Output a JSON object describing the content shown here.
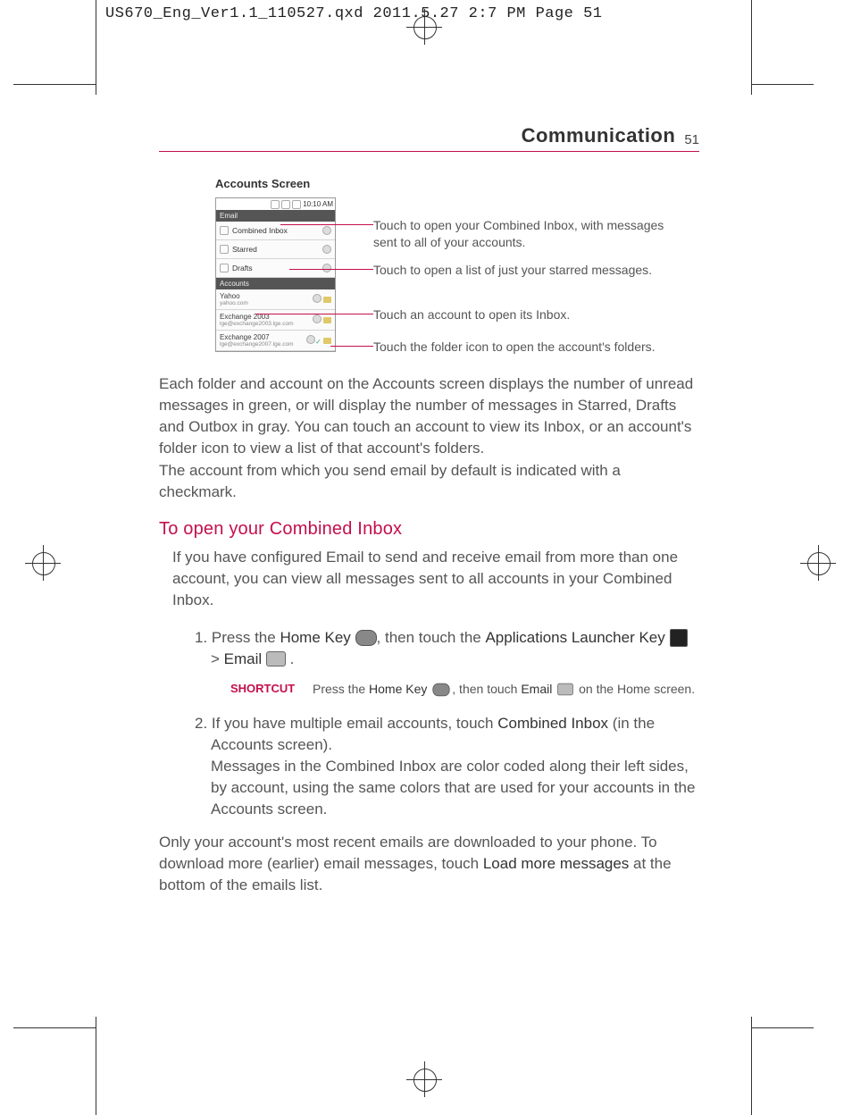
{
  "file_header": "US670_Eng_Ver1.1_110527.qxd  2011.5.27  2:7 PM  Page 51",
  "chapter": {
    "title": "Communication",
    "page_number": "51"
  },
  "figure_caption": "Accounts Screen",
  "phone": {
    "time": "10:10 AM",
    "section_email": "Email",
    "combined_inbox": "Combined Inbox",
    "starred": "Starred",
    "drafts": "Drafts",
    "section_accounts": "Accounts",
    "acc1_name": "Yahoo",
    "acc1_sub": "yahoo.com",
    "acc2_name": "Exchange 2003",
    "acc2_sub": "lge@exchange2003.lge.com",
    "acc3_name": "Exchange 2007",
    "acc3_sub": "lge@exchange2007.lge.com"
  },
  "callouts": {
    "c1": "Touch to open your Combined Inbox, with messages sent to all of your accounts.",
    "c2": "Touch to open a list of just your starred messages.",
    "c3": "Touch an account to open its Inbox.",
    "c4": "Touch the folder icon to open the account's folders."
  },
  "para1": "Each folder and account on the Accounts screen displays the number of unread messages in green, or will display the number of messages in Starred, Drafts and Outbox in gray. You can touch an account to view its Inbox, or an account's folder icon to view a list of that account's folders.",
  "para1b": "The account from which you send email by default is indicated with a checkmark.",
  "h2": "To open your Combined Inbox",
  "para2": "If you have configured Email to send and receive email from more than one account, you can view all messages sent to all accounts in your Combined Inbox.",
  "step1_a": "1. Press the ",
  "step1_home": "Home Key",
  "step1_b": ", then touch the ",
  "step1_apps": "Applications Launcher Key",
  "step1_c": " > ",
  "step1_email": "Email",
  "step1_d": " .",
  "shortcut_label": "SHORTCUT",
  "shortcut_a": "Press the ",
  "shortcut_home": "Home Key",
  "shortcut_b": ", then touch ",
  "shortcut_email": "Email",
  "shortcut_c": " on the Home screen.",
  "step2_a": "2. If you have multiple email accounts, touch ",
  "step2_combined": "Combined Inbox",
  "step2_b": " (in the Accounts screen).",
  "step2_c": "Messages in the Combined Inbox are color coded along their left sides, by account, using the same colors that are used for your accounts in the Accounts screen.",
  "para3_a": "Only your account's most recent emails are downloaded to your phone. To download more (earlier) email messages, touch ",
  "para3_load": "Load more messages",
  "para3_b": " at the bottom of the emails list."
}
